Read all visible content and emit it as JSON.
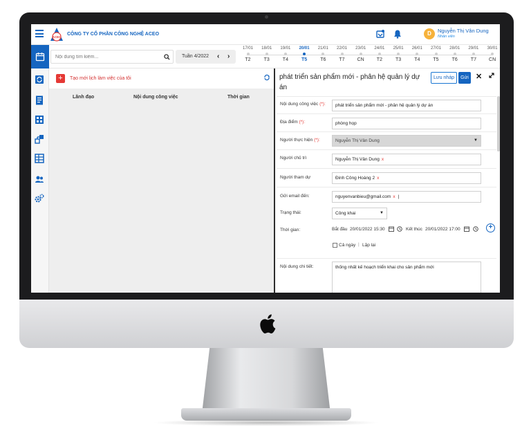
{
  "header": {
    "company": "CÔNG TY CỔ PHẦN CÔNG NGHỆ ACEO",
    "logo_text": "ACEO",
    "user_initial": "D",
    "user_name": "Nguyễn Thị Vân Dung",
    "user_role": "Nhân viên"
  },
  "toolbar": {
    "search_placeholder": "Nội dung tìm kiếm...",
    "week_label": "Tuần 4/2022",
    "days": [
      {
        "date": "17/01",
        "weekday": "T2",
        "active": false
      },
      {
        "date": "18/01",
        "weekday": "T3",
        "active": false
      },
      {
        "date": "19/01",
        "weekday": "T4",
        "active": false
      },
      {
        "date": "20/01",
        "weekday": "T5",
        "active": true
      },
      {
        "date": "21/01",
        "weekday": "T6",
        "active": false
      },
      {
        "date": "22/01",
        "weekday": "T7",
        "active": false
      },
      {
        "date": "23/01",
        "weekday": "CN",
        "active": false
      },
      {
        "date": "24/01",
        "weekday": "T2",
        "active": false
      },
      {
        "date": "25/01",
        "weekday": "T3",
        "active": false
      },
      {
        "date": "26/01",
        "weekday": "T4",
        "active": false
      },
      {
        "date": "27/01",
        "weekday": "T5",
        "active": false
      },
      {
        "date": "28/01",
        "weekday": "T6",
        "active": false
      },
      {
        "date": "29/01",
        "weekday": "T7",
        "active": false
      },
      {
        "date": "30/01",
        "weekday": "CN",
        "active": false
      }
    ]
  },
  "left_panel": {
    "add_label": "Tạo mới lịch làm việc của tôi",
    "columns": [
      "Lãnh đạo",
      "Nội dung công việc",
      "Thời gian"
    ]
  },
  "right_panel": {
    "title": "phát triển sản phẩm mới - phân hệ quản lý dự án",
    "draft_button": "Lưu nháp",
    "send_button": "Gửi",
    "labels": {
      "task": "Nội dung công việc",
      "location": "Địa điểm",
      "assignee": "Người thực hiện",
      "chair": "Người chủ trì",
      "participants": "Người tham dự",
      "email": "Gửi email đến:",
      "status": "Trạng thái:",
      "time": "Thời gian:",
      "detail": "Nội dung chi tiết:"
    },
    "required_mark": "(*):",
    "values": {
      "task": "phát triển sản phẩm mới - phân hệ quản lý dự án",
      "location": "phòng họp",
      "assignee": "Nguyễn Thị Vân Dung",
      "chair": "Nguyễn Thị Vân Dung",
      "participants": "Đinh Công Hoàng 2",
      "email": "nguyenvanbieu@gmail.com",
      "status": "Công khai",
      "start_label": "Bắt đầu",
      "start_value": "20/01/2022 15:30",
      "end_label": "Kết thúc",
      "end_value": "20/01/2022 17:00",
      "all_day": "Cả ngày",
      "repeat": "Lặp lại",
      "detail": "thống nhất kế hoạch triển khai cho sản phẩm mới"
    },
    "tag_remove": "x"
  },
  "colors": {
    "brand": "#1565c0",
    "danger": "#e53935",
    "bezel": "#1c1c1e"
  }
}
